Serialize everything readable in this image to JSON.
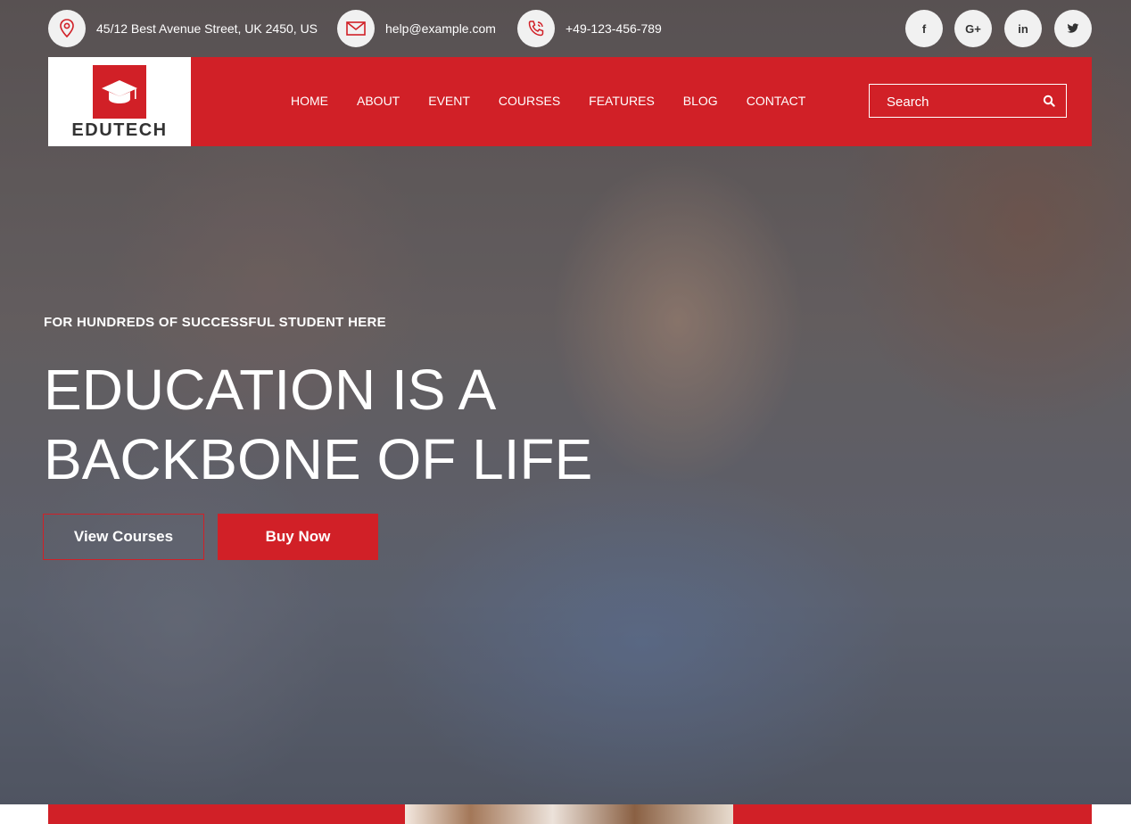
{
  "topbar": {
    "address": "45/12 Best Avenue Street, UK 2450, US",
    "email": "help@example.com",
    "phone": "+49-123-456-789",
    "icons": [
      "location-pin-icon",
      "envelope-icon",
      "phone-icon"
    ],
    "social": [
      {
        "icon": "facebook-icon",
        "label": "f"
      },
      {
        "icon": "google-plus-icon",
        "label": "G+"
      },
      {
        "icon": "linkedin-icon",
        "label": "in"
      },
      {
        "icon": "twitter-icon",
        "label": "twitter"
      }
    ]
  },
  "header": {
    "logo_text": "EDUTECH",
    "logo_icon": "graduation-cap-icon",
    "nav": [
      "HOME",
      "ABOUT",
      "EVENT",
      "COURSES",
      "FEATURES",
      "BLOG",
      "CONTACT"
    ],
    "search": {
      "placeholder": "Search",
      "icon": "search-icon"
    }
  },
  "hero": {
    "tagline": "FOR HUNDREDS OF SUCCESSFUL STUDENT HERE",
    "headline_line1": "EDUCATION IS A",
    "headline_line2": "BACKBONE OF LIFE",
    "primary_button": "View Courses",
    "secondary_button": "Buy Now"
  },
  "colors": {
    "brand_red": "#d12027",
    "white": "#ffffff",
    "icon_circle": "#f1f1f1"
  }
}
